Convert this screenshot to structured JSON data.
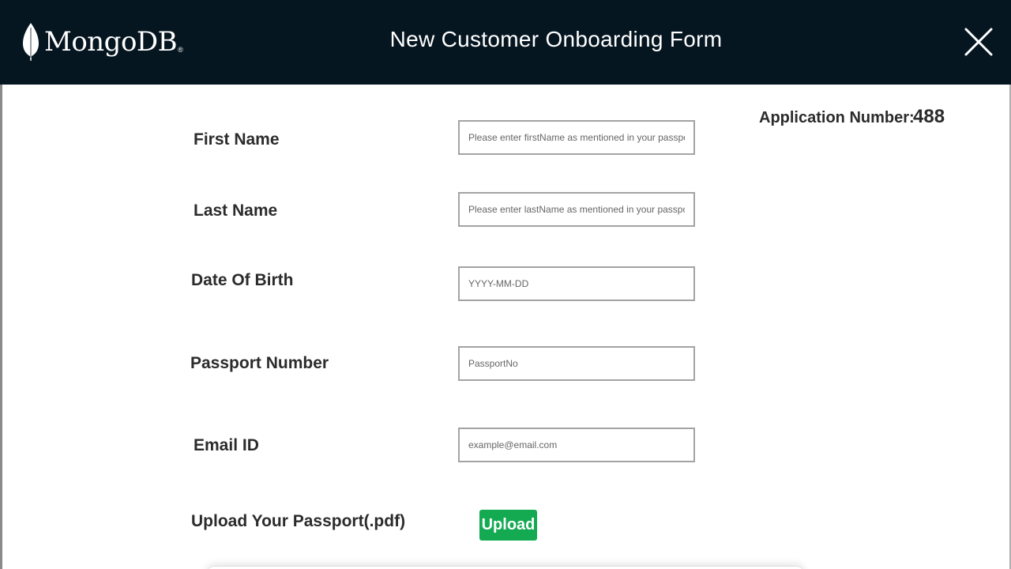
{
  "header": {
    "logo_text": "MongoDB",
    "logo_reg": "®",
    "title": "New Customer Onboarding Form",
    "close_icon": "close-icon",
    "background": "#061621"
  },
  "application": {
    "label": "Application Number:",
    "value": "488"
  },
  "form": {
    "first_name": {
      "label": "First Name",
      "placeholder": "Please enter firstName as mentioned in your passport"
    },
    "last_name": {
      "label": "Last Name",
      "placeholder": "Please enter lastName as mentioned in your passport"
    },
    "dob": {
      "label": "Date Of Birth",
      "placeholder": "YYYY-MM-DD"
    },
    "passport": {
      "label": "Passport Number",
      "placeholder": "PassportNo"
    },
    "email": {
      "label": "Email ID",
      "placeholder": "example@email.com"
    },
    "upload": {
      "label": "Upload Your Passport(.pdf)",
      "button_label": "Upload",
      "button_color": "#13aa52"
    }
  }
}
